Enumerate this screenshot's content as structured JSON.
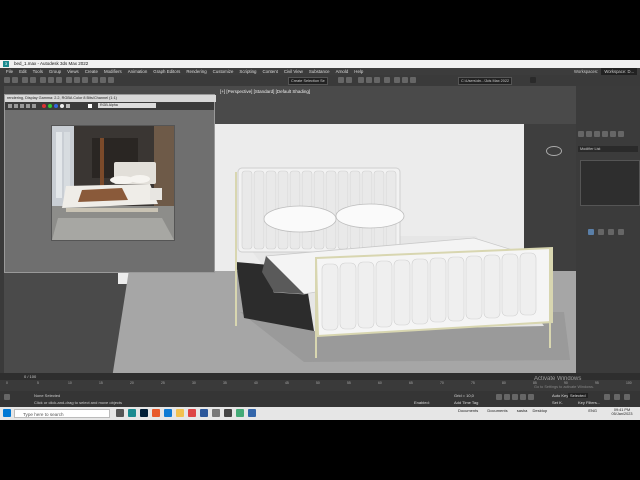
{
  "window": {
    "title": "bed_1.max - Autodesk 3ds Max 2022"
  },
  "menu": {
    "items": [
      "File",
      "Edit",
      "Tools",
      "Group",
      "Views",
      "Create",
      "Modifiers",
      "Animation",
      "Graph Editors",
      "Rendering",
      "Customize",
      "Scripting",
      "Content",
      "Civil View",
      "Substance",
      "Arnold",
      "Help"
    ],
    "workspaces_label": "Workspaces:",
    "workspace_value": "Workspace: D..."
  },
  "toolbar": {
    "selection_set": "Create Selection Se",
    "path": "C:\\Users\\dn...\\3ds Max 2022"
  },
  "viewport": {
    "label": "[+] [Perspective] [Standard] [Default Shading]"
  },
  "frame_buffer": {
    "title": "rendering, Display Gamma: 2.2, RGBA Color 8 Bits/Channel (1:1)",
    "channel": "RGB Alpha"
  },
  "command_panel": {
    "modifier_list": "Modifier List"
  },
  "timeline": {
    "counter": "0 / 100",
    "ticks": [
      "0",
      "5",
      "10",
      "15",
      "20",
      "25",
      "30",
      "35",
      "40",
      "45",
      "50",
      "55",
      "60",
      "65",
      "70",
      "75",
      "80",
      "85",
      "90",
      "95",
      "100"
    ]
  },
  "status": {
    "selection": "None Selected",
    "prompt": "Click or click-and-drag to select and move objects",
    "grid": "Grid = 10,0",
    "add_time_tag": "Add Time Tag",
    "enabled": "Enabled:",
    "auto_key": "Auto Key",
    "selected": "Selected",
    "set_key": "Set K.",
    "key_filters": "Key Filters..."
  },
  "activation": {
    "title": "Activate Windows",
    "subtitle": "Go to Settings to activate Windows."
  },
  "taskbar": {
    "search_placeholder": "Type here to search",
    "tray_items": [
      "Documents",
      "Documents",
      "sasha",
      "Desktop"
    ],
    "lang": "ENG",
    "time": "09:41 PM",
    "date": "05/Jan/2023"
  },
  "colors": {
    "bed_fabric": "#f0f0f0",
    "bed_frame": "#d8d6b0",
    "viewport_wall": "#ececec",
    "accent_ui": "#1a8a8f"
  }
}
